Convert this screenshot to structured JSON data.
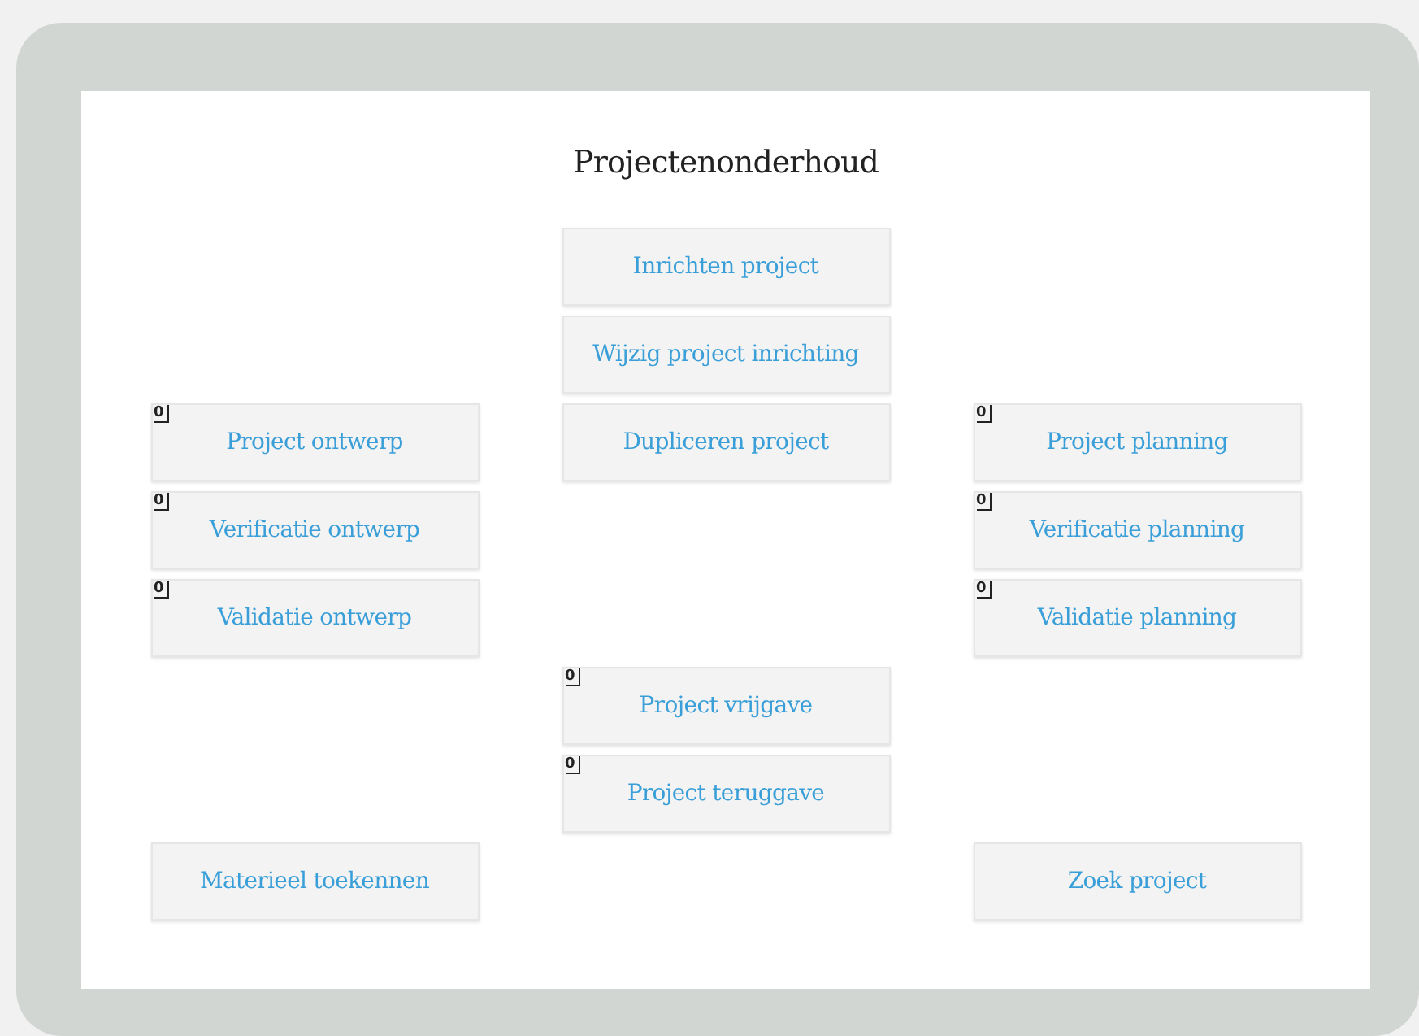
{
  "title": "Projectenonderhoud",
  "rows": [
    {
      "center": {
        "label": "Inrichten project"
      }
    },
    {
      "center": {
        "label": "Wijzig project inrichting"
      }
    },
    {
      "left": {
        "label": "Project ontwerp",
        "badge": "0"
      },
      "center": {
        "label": "Dupliceren project"
      },
      "right": {
        "label": "Project planning",
        "badge": "0"
      }
    },
    {
      "left": {
        "label": "Verificatie ontwerp",
        "badge": "0"
      },
      "right": {
        "label": "Verificatie planning",
        "badge": "0"
      }
    },
    {
      "left": {
        "label": "Validatie ontwerp",
        "badge": "0"
      },
      "right": {
        "label": "Validatie planning",
        "badge": "0"
      }
    },
    {
      "center": {
        "label": "Project vrijgave",
        "badge": "0"
      }
    },
    {
      "center": {
        "label": "Project teruggave",
        "badge": "0"
      }
    },
    {
      "left": {
        "label": "Materieel toekennen"
      },
      "right": {
        "label": "Zoek project"
      }
    }
  ]
}
